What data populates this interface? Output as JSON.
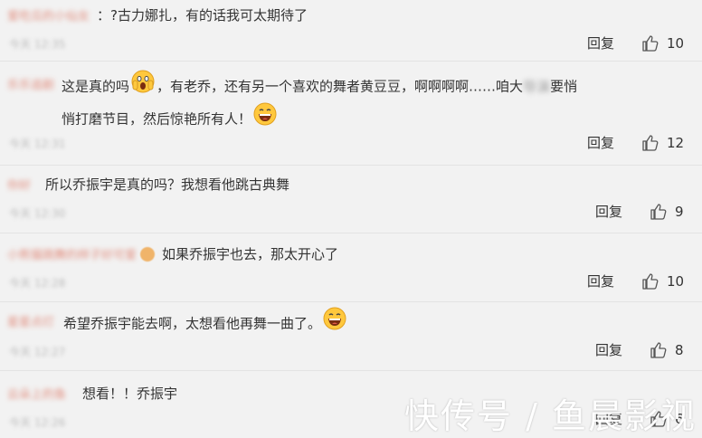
{
  "reply_label": "回复",
  "comments": [
    {
      "username": "爱吃瓜的小仙女",
      "text": "：?古力娜扎，有的话我可太期待了",
      "time": "今天 12:35",
      "likes": "10"
    },
    {
      "username": "乐乐追剧",
      "text_a": "这是真的吗",
      "text_b": "，有老乔，还有另一个喜欢的舞者黄豆豆，啊啊啊啊……咱大",
      "text_blur": "导演",
      "text_c": "要悄",
      "text_d": "悄打磨节目，然后惊艳所有人！",
      "time": "今天 12:31",
      "likes": "12"
    },
    {
      "username": "你好",
      "text": "所以乔振宇是真的吗？我想看他跳古典舞",
      "time": "今天 12:30",
      "likes": "9"
    },
    {
      "username": "小熊猫跳舞的样子好可爱",
      "text": "如果乔振宇也去，那太开心了",
      "time": "今天 12:28",
      "likes": "10"
    },
    {
      "username": "星星点灯",
      "text": "希望乔振宇能去啊，太想看他再舞一曲了。",
      "time": "今天 12:27",
      "likes": "8"
    },
    {
      "username": "云朵上的鱼",
      "text": "想看！！乔振宇",
      "time": "今天 12:26",
      "likes": "6"
    }
  ],
  "watermark": "快传号 / 鱼晨影视",
  "icons": {
    "like": "thumbs-up-icon",
    "emoji_shock": "screaming-face-icon",
    "emoji_laugh": "laughing-face-icon"
  }
}
